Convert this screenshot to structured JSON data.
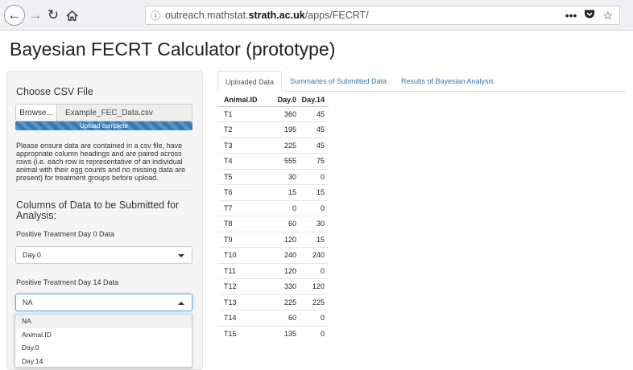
{
  "browser": {
    "url_host_prefix": "outreach.mathstat.",
    "url_host_domain": "strath.ac.uk",
    "url_path": "/apps/FECRT/"
  },
  "page": {
    "title": "Bayesian FECRT Calculator (prototype)"
  },
  "sidebar": {
    "choose_label": "Choose CSV File",
    "browse_label": "Browse...",
    "file_name": "Example_FEC_Data.csv",
    "progress_label": "Upload complete",
    "progress_fraction": 1.0,
    "help_text": "Please ensure data are contained in a csv file, have appropriate column headings and are paired across rows (i.e. each row is representative of an individual animal with their egg counts and no missing data are present) for treatment groups before upload.",
    "columns_heading": "Columns of Data to be Submitted for Analysis:",
    "day0_label": "Positive Treatment Day 0 Data",
    "day0_value": "Day.0",
    "day14_label": "Positive Treatment Day 14 Data",
    "day14_value": "NA",
    "day14_options": [
      "NA",
      "Animal.ID",
      "Day.0",
      "Day.14"
    ]
  },
  "tabs": [
    "Uploaded Data",
    "Summaries of Submitted Data",
    "Results of Bayesian Analysis"
  ],
  "table": {
    "headers": [
      "Animal.ID",
      "Day.0",
      "Day.14"
    ],
    "rows": [
      [
        "T1",
        "360",
        "45"
      ],
      [
        "T2",
        "195",
        "45"
      ],
      [
        "T3",
        "225",
        "45"
      ],
      [
        "T4",
        "555",
        "75"
      ],
      [
        "T5",
        "30",
        "0"
      ],
      [
        "T6",
        "15",
        "15"
      ],
      [
        "T7",
        "0",
        "0"
      ],
      [
        "T8",
        "60",
        "30"
      ],
      [
        "T9",
        "120",
        "15"
      ],
      [
        "T10",
        "240",
        "240"
      ],
      [
        "T11",
        "120",
        "0"
      ],
      [
        "T12",
        "330",
        "120"
      ],
      [
        "T13",
        "225",
        "225"
      ],
      [
        "T14",
        "60",
        "0"
      ],
      [
        "T15",
        "135",
        "0"
      ]
    ]
  },
  "colors": {
    "accent": "#337ab7",
    "link": "#337ab7"
  }
}
